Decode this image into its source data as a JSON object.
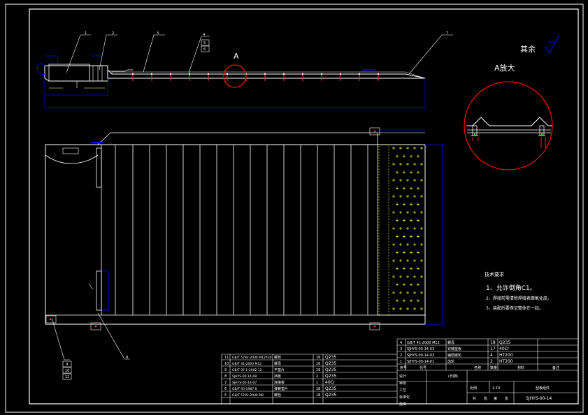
{
  "drawing": {
    "view_label": "A",
    "detail_title": "A放大",
    "surface_note": "其余",
    "leader_numbers": [
      "1",
      "2",
      "3",
      "4",
      "5",
      "6",
      "7",
      "8",
      "9",
      "10",
      "11"
    ],
    "tech_requirements": {
      "title": "技术要求",
      "items": [
        "1、允许倒角C1。",
        "2、焊接前需清除焊接表面氧化皮。",
        "3、装配后要保证整体在一起。"
      ]
    }
  },
  "title_block": {
    "parts_top": [
      {
        "no": "4",
        "code": "GB/T 41-2000 M12",
        "name": "螺母",
        "qty": "18",
        "material": "Q235"
      },
      {
        "no": "3",
        "code": "SJHYS-00-14-03",
        "name": "铰链座板",
        "qty": "17",
        "material": "40Cr"
      },
      {
        "no": "2",
        "code": "SJHYS-00-14-02",
        "name": "辅助链轮",
        "qty": "4",
        "material": "HT200"
      },
      {
        "no": "1",
        "code": "SJHYS-00-14-01",
        "name": "齿轮",
        "qty": "2",
        "material": "HT200"
      }
    ],
    "parts_header": {
      "no": "序号",
      "code": "代号",
      "name": "名称",
      "qty": "数量",
      "material": "材料",
      "remark": "备注"
    },
    "parts_left": [
      {
        "no": "11",
        "code": "GB/T 5782-2000 M12X30",
        "name": "螺栓",
        "qty": "16",
        "material": "Q235"
      },
      {
        "no": "10",
        "code": "GB/T 41-2000 M12",
        "name": "螺母",
        "qty": "16",
        "material": "Q235"
      },
      {
        "no": "9",
        "code": "GB/T 97.1-2002 12",
        "name": "平垫片",
        "qty": "16",
        "material": "Q235"
      },
      {
        "no": "8",
        "code": "SJHYS-00-14-08",
        "name": "挡板",
        "qty": "2",
        "material": "Q235"
      },
      {
        "no": "7",
        "code": "SJHYS-00-14-07",
        "name": "连接板",
        "qty": "1",
        "material": "40Cr"
      },
      {
        "no": "6",
        "code": "GB/T 93-1987 8",
        "name": "弹簧垫片",
        "qty": "18",
        "material": "Q235"
      },
      {
        "no": "5",
        "code": "GB/T 5782-2000 M8",
        "name": "螺栓",
        "qty": "18",
        "material": "Q235"
      }
    ],
    "sign_rows": [
      "设计",
      "审核",
      "工艺",
      "标准化",
      "批准"
    ],
    "stage_label": "(日期)",
    "scale_label": "比例",
    "scale": "1:10",
    "drawing_name": "刮板组件",
    "bottom_labels": [
      "共",
      "张",
      "第",
      "张"
    ],
    "drawing_number": "SJHYS-00-14"
  },
  "colors": {
    "background": "#000000",
    "line": "#ffffff",
    "dimension": "#0000ff",
    "detail_circle": "#ff0000",
    "hatch": "#ffff00"
  }
}
